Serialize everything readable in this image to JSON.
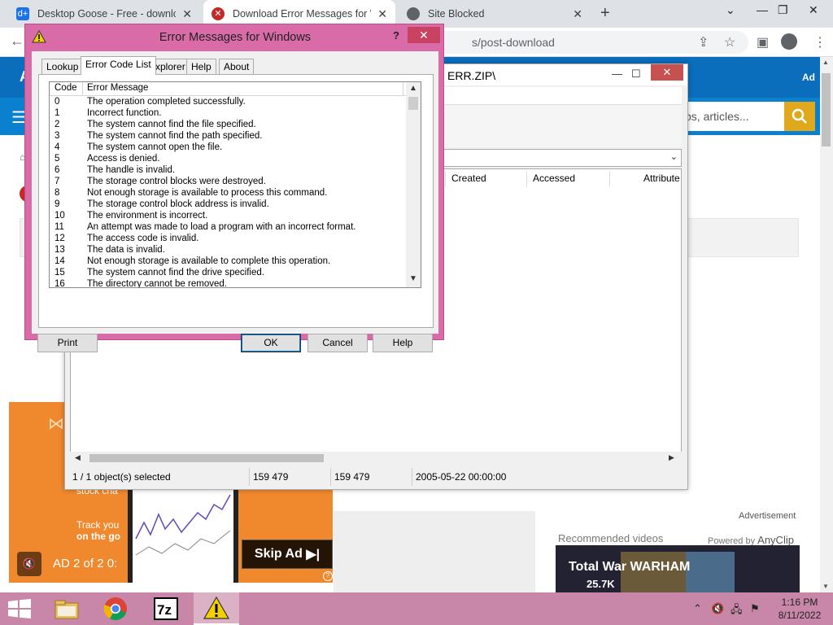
{
  "browser": {
    "tabs": [
      {
        "title": "Desktop Goose - Free - downloa",
        "icon": "desktop-goose-favicon",
        "color": "#1a73e8"
      },
      {
        "title": "Download Error Messages for W",
        "icon": "error-favicon",
        "color": "#c62828"
      },
      {
        "title": "Site Blocked",
        "icon": "globe-icon",
        "color": "#5f6368"
      }
    ],
    "address_partial": "s/post-download"
  },
  "page": {
    "header_letter": "A",
    "header_ad": "Ad",
    "search_placeholder": "ps, articles...",
    "advertisement_label": "Advertisement",
    "recommended_label": "Recommended videos",
    "powered_by": "Powered by",
    "powered_brand": "AnyClip",
    "video_title": "Total War WARHAM",
    "video_views": "25.7K"
  },
  "video_ad": {
    "text1": "stock cha",
    "text2": "Track you",
    "text3": "on the go",
    "counter": "AD 2 of 2  0:",
    "skip_label": "Skip Ad",
    "info": "?"
  },
  "zip_window": {
    "title": "ERR.ZIP\\",
    "columns": [
      "Created",
      "Accessed",
      "Attribute"
    ],
    "status": {
      "selected": "1 / 1 object(s) selected",
      "size": "159 479",
      "packed": "159 479",
      "date": "2005-05-22 00:00:00"
    }
  },
  "dialog": {
    "title": "Error Messages for Windows",
    "help_glyph": "?",
    "tabs": [
      "Lookup",
      "Error Code List",
      "Explorer",
      "Help",
      "About"
    ],
    "active_tab": "Error Code List",
    "columns": {
      "code": "Code",
      "message": "Error Message"
    },
    "rows": [
      {
        "code": "0",
        "message": "The operation completed successfully."
      },
      {
        "code": "1",
        "message": "Incorrect function."
      },
      {
        "code": "2",
        "message": "The system cannot find the file specified."
      },
      {
        "code": "3",
        "message": "The system cannot find the path specified."
      },
      {
        "code": "4",
        "message": "The system cannot open the file."
      },
      {
        "code": "5",
        "message": "Access is denied."
      },
      {
        "code": "6",
        "message": "The handle is invalid."
      },
      {
        "code": "7",
        "message": "The storage control blocks were destroyed."
      },
      {
        "code": "8",
        "message": "Not enough storage is available to process this command."
      },
      {
        "code": "9",
        "message": "The storage control block address is invalid."
      },
      {
        "code": "10",
        "message": "The environment is incorrect."
      },
      {
        "code": "11",
        "message": "An attempt was made to load a program with an incorrect format."
      },
      {
        "code": "12",
        "message": "The access code is invalid."
      },
      {
        "code": "13",
        "message": "The data is invalid."
      },
      {
        "code": "14",
        "message": "Not enough storage is available to complete this operation."
      },
      {
        "code": "15",
        "message": "The system cannot find the drive specified."
      },
      {
        "code": "16",
        "message": "The directory cannot be removed."
      }
    ],
    "buttons": {
      "print": "Print",
      "ok": "OK",
      "cancel": "Cancel",
      "help": "Help"
    }
  },
  "taskbar": {
    "apps": [
      "file-explorer-icon",
      "chrome-icon",
      "7zip-icon",
      "error-messages-icon"
    ],
    "time": "1:16 PM",
    "date": "8/11/2022",
    "color": "#c887a8"
  }
}
